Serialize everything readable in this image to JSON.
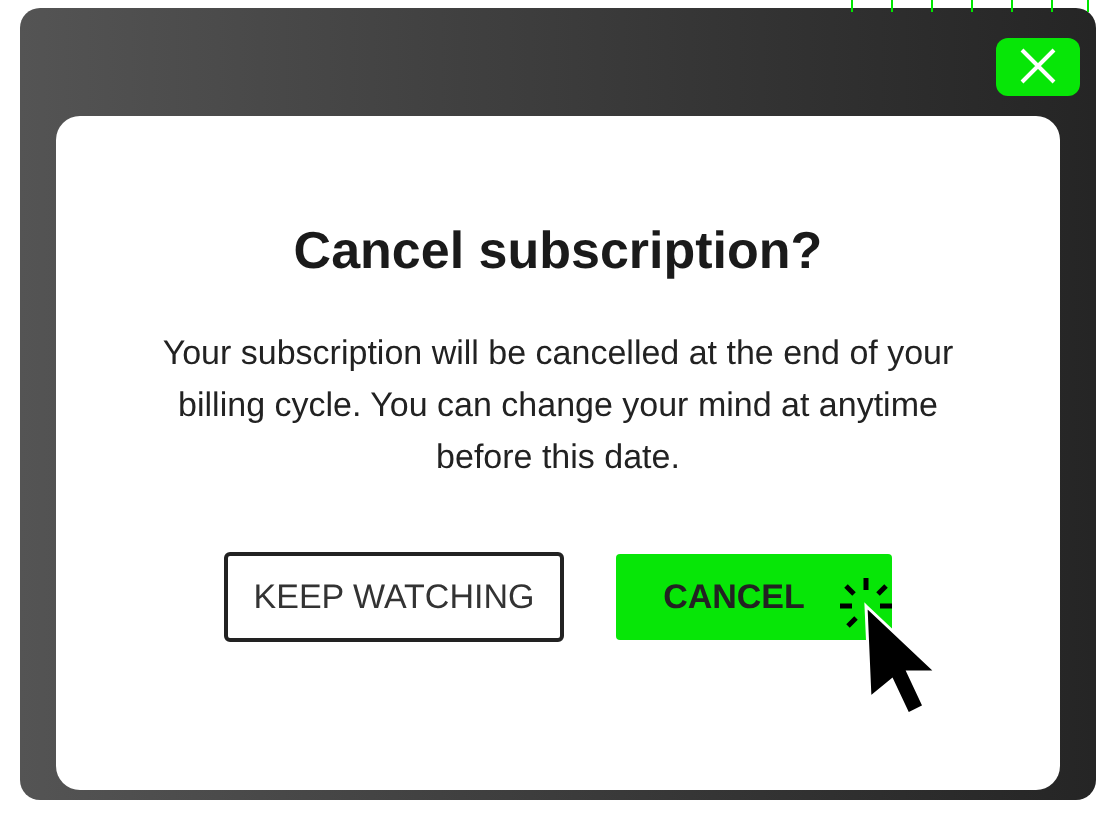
{
  "dialog": {
    "title": "Cancel subscription?",
    "message": "Your subscription will be cancelled at the end of your billing cycle. You can change your mind at anytime before this date.",
    "buttons": [
      {
        "label": "KEEP WATCHING",
        "kind": "secondary"
      },
      {
        "label": "CANCEL",
        "kind": "primary"
      }
    ]
  }
}
